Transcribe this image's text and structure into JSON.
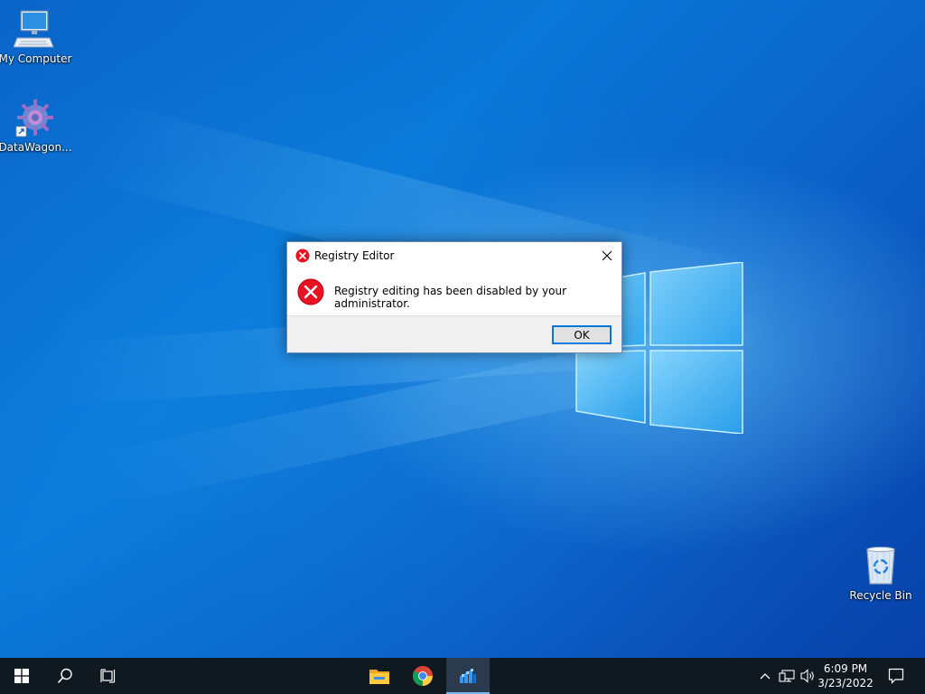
{
  "desktop": {
    "icons": [
      {
        "label": "My Computer",
        "icon": "computer-icon"
      },
      {
        "label": "DataWagon...",
        "icon": "datawagon-icon"
      },
      {
        "label": "Recycle Bin",
        "icon": "recycle-bin-icon"
      }
    ]
  },
  "dialog": {
    "title": "Registry Editor",
    "message": "Registry editing has been disabled by your administrator.",
    "ok_label": "OK",
    "close_icon": "close-icon",
    "error_icon": "error-icon",
    "error_color": "#e81123"
  },
  "taskbar": {
    "pinned": [
      {
        "icon": "start-icon"
      },
      {
        "icon": "search-icon"
      },
      {
        "icon": "task-view-icon"
      },
      {
        "icon": "file-explorer-icon"
      },
      {
        "icon": "chrome-icon"
      },
      {
        "icon": "registry-editor-icon"
      }
    ],
    "tray": [
      {
        "icon": "chevron-up-icon"
      },
      {
        "icon": "network-icon"
      },
      {
        "icon": "volume-icon"
      },
      {
        "icon": "notifications-icon"
      }
    ],
    "clock": {
      "time": "6:09 PM",
      "date": "3/23/2022"
    },
    "accent": "#76b9ed"
  }
}
